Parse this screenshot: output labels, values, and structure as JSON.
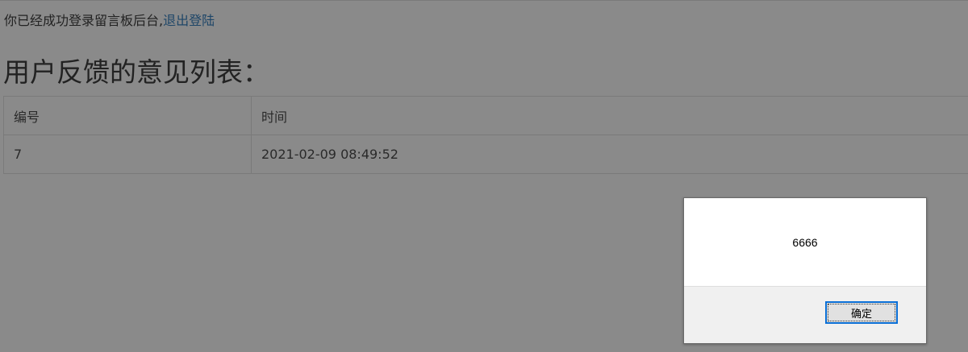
{
  "header": {
    "login_text": "你已经成功登录留言板后台,",
    "logout_link": "退出登陆"
  },
  "page_title": "用户反馈的意见列表：",
  "table": {
    "columns": [
      "编号",
      "时间"
    ],
    "rows": [
      [
        "7",
        "2021-02-09 08:49:52"
      ]
    ]
  },
  "alert": {
    "message": "6666",
    "ok_label": "确定"
  },
  "colors": {
    "overlay_bg": "#8a8a8a",
    "link": "#1e4668",
    "button_focus": "#0a6fd6"
  }
}
